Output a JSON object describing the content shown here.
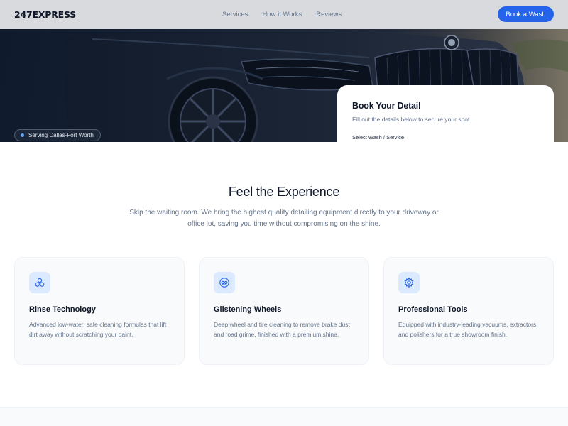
{
  "header": {
    "logo": "247EXPRESS",
    "nav": [
      "Services",
      "How it Works",
      "Reviews"
    ],
    "cta_label": "Book a Wash"
  },
  "hero": {
    "badge": "Serving Dallas-Fort Worth"
  },
  "booking": {
    "title": "Book Your Detail",
    "subtitle": "Fill out the details below to secure your spot.",
    "field_label": "Select Wash / Service"
  },
  "experience": {
    "title": "Feel the Experience",
    "description": "Skip the waiting room. We bring the highest quality detailing equipment directly to your driveway or office lot, saving you time without compromising on the shine.",
    "cards": [
      {
        "icon": "bubbles-icon",
        "title": "Rinse Technology",
        "text": "Advanced low-water, safe cleaning formulas that lift dirt away without scratching your paint."
      },
      {
        "icon": "wheel-icon",
        "title": "Glistening Wheels",
        "text": "Deep wheel and tire cleaning to remove brake dust and road grime, finished with a premium shine."
      },
      {
        "icon": "gear-icon",
        "title": "Professional Tools",
        "text": "Equipped with industry-leading vacuums, extractors, and polishers for a true showroom finish."
      }
    ]
  },
  "colors": {
    "accent": "#2563eb",
    "icon_bg": "#dbeafe",
    "text_dark": "#0f172a",
    "text_muted": "#64748b"
  }
}
